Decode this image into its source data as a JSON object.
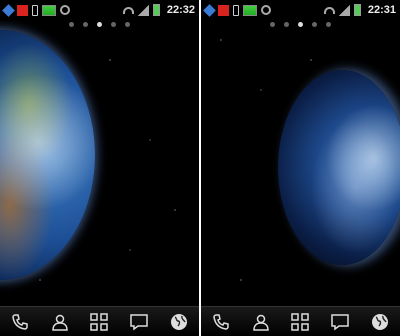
{
  "screens": [
    {
      "id": "left",
      "status_time": "22:32",
      "page_dots": 5,
      "active_dot": 2,
      "dock": [
        "phone-icon",
        "contacts-icon",
        "apps-grid-icon",
        "messages-icon",
        "browser-globe-icon"
      ]
    },
    {
      "id": "right",
      "status_time": "22:31",
      "page_dots": 5,
      "active_dot": 2,
      "dock": [
        "phone-icon",
        "contacts-icon",
        "apps-grid-icon",
        "messages-icon",
        "browser-globe-icon"
      ]
    }
  ],
  "colors": {
    "space_background": "#000000",
    "dock_icon": "#dddddd"
  }
}
